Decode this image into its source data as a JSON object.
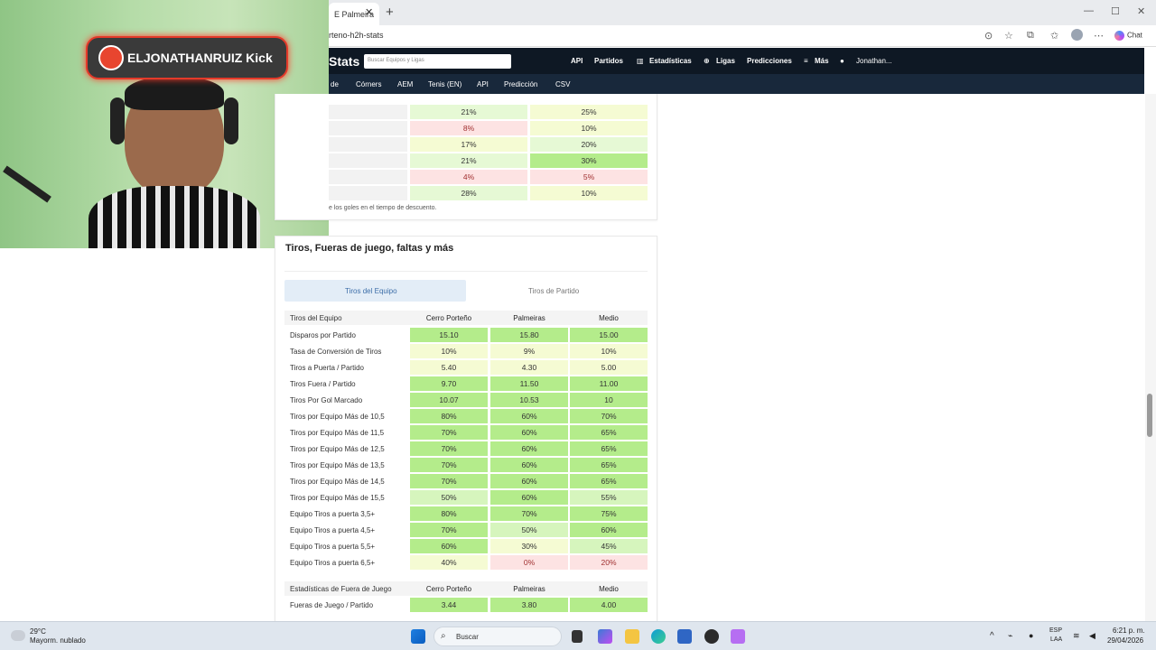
{
  "browser": {
    "tab_title": "E Palmeira",
    "url_fragment": "rteno-h2h-stats",
    "chat_label": "Chat"
  },
  "header": {
    "brand": "Stats",
    "search_placeholder": "Buscar Equipos y Ligas",
    "nav": [
      "API",
      "Partidos",
      "Estadísticas",
      "Ligas",
      "Predicciones",
      "Más"
    ],
    "user": "Jonathan...",
    "subnav": [
      "de",
      "Córners",
      "AEM",
      "Tenis (EN)",
      "API",
      "Predicción",
      "CSV"
    ]
  },
  "webcam": {
    "overlay_text": "ELJONATHANRUIZ Kick"
  },
  "top_table": {
    "rows": [
      {
        "a": "21%",
        "b": "25%"
      },
      {
        "a": "8%",
        "b": "10%"
      },
      {
        "a": "17%",
        "b": "20%"
      },
      {
        "a": "21%",
        "b": "30%"
      },
      {
        "a": "4%",
        "b": "5%"
      },
      {
        "a": "28%",
        "b": "10%"
      }
    ],
    "footnote": "e los goles en el tiempo de descuento."
  },
  "shots_section": {
    "title": "Tiros, Fueras de juego, faltas y más",
    "tabs": [
      "Tiros del Equipo",
      "Tiros de Partido"
    ],
    "headers": [
      "Tiros del Equipo",
      "Cerro Porteño",
      "Palmeiras",
      "Medio"
    ],
    "rows": [
      {
        "label": "Disparos por Partido",
        "a": "15.10",
        "b": "15.80",
        "m": "15.00"
      },
      {
        "label": "Tasa de Conversión de Tiros",
        "a": "10%",
        "b": "9%",
        "m": "10%"
      },
      {
        "label": "Tiros a Puerta / Partido",
        "a": "5.40",
        "b": "4.30",
        "m": "5.00"
      },
      {
        "label": "Tiros Fuera / Partido",
        "a": "9.70",
        "b": "11.50",
        "m": "11.00"
      },
      {
        "label": "Tiros Por Gol Marcado",
        "a": "10.07",
        "b": "10.53",
        "m": "10"
      },
      {
        "label": "Tiros por Equipo Más de 10,5",
        "a": "80%",
        "b": "60%",
        "m": "70%"
      },
      {
        "label": "Tiros por Equipo Más de 11,5",
        "a": "70%",
        "b": "60%",
        "m": "65%"
      },
      {
        "label": "Tiros por Equipo Más de 12,5",
        "a": "70%",
        "b": "60%",
        "m": "65%"
      },
      {
        "label": "Tiros por Equipo Más de 13,5",
        "a": "70%",
        "b": "60%",
        "m": "65%"
      },
      {
        "label": "Tiros por Equipo Más de 14,5",
        "a": "70%",
        "b": "60%",
        "m": "65%"
      },
      {
        "label": "Tiros por Equipo Más de 15,5",
        "a": "50%",
        "b": "60%",
        "m": "55%"
      },
      {
        "label": "Equipo Tiros a puerta 3,5+",
        "a": "80%",
        "b": "70%",
        "m": "75%"
      },
      {
        "label": "Equipo Tiros a puerta 4,5+",
        "a": "70%",
        "b": "50%",
        "m": "60%"
      },
      {
        "label": "Equipo Tiros a puerta 5,5+",
        "a": "60%",
        "b": "30%",
        "m": "45%"
      },
      {
        "label": "Equipo Tiros a puerta 6,5+",
        "a": "40%",
        "b": "0%",
        "m": "20%"
      }
    ],
    "offside_headers": [
      "Estadísticas de Fuera de Juego",
      "Cerro Porteño",
      "Palmeiras",
      "Medio"
    ],
    "offside_rows": [
      {
        "label": "Fueras de Juego / Partido",
        "a": "3.44",
        "b": "3.80",
        "m": "4.00"
      }
    ]
  },
  "taskbar": {
    "weather_temp": "29°C",
    "weather_desc": "Mayorm. nublado",
    "search_label": "Buscar",
    "lang_top": "ESP",
    "lang_bottom": "LAA",
    "time": "6:21 p. m.",
    "date": "29/04/2026"
  },
  "colors": {
    "nav_bg": "#0e1824",
    "subnav_bg": "#18283b",
    "green_strong": "#b4ec8b",
    "green_light": "#d6f5bd",
    "yellow": "#f5fbd3",
    "red": "#fde3e3"
  }
}
